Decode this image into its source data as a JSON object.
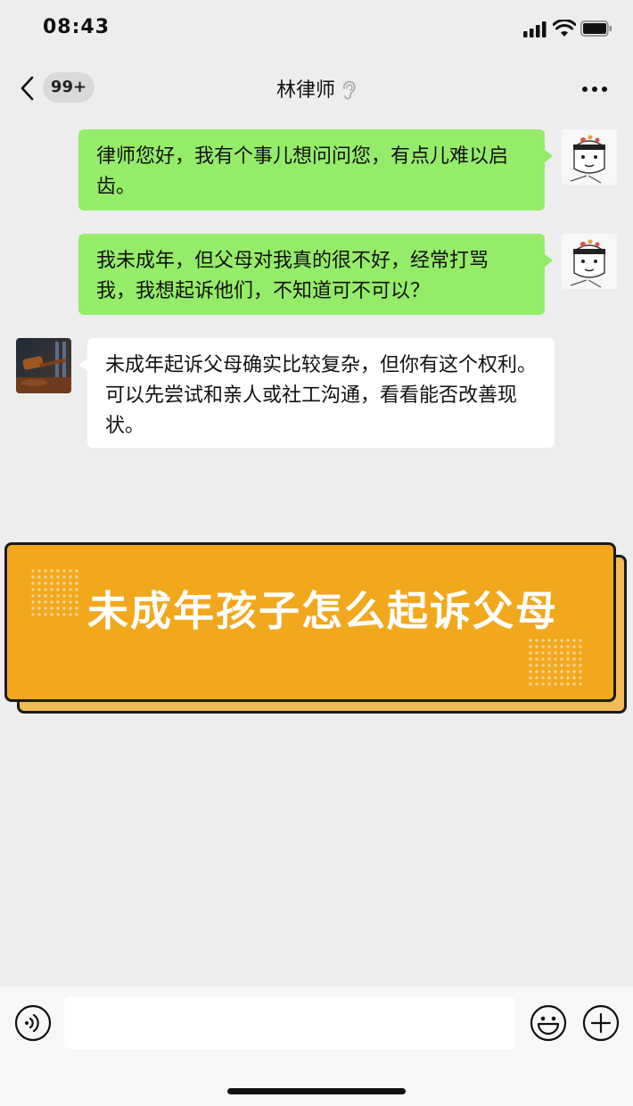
{
  "status_bar": {
    "time": "08:43"
  },
  "nav": {
    "unread_badge": "99+",
    "title": "林律师",
    "ear_icon": "ear-icon",
    "more_icon": "more-dots-icon"
  },
  "messages": [
    {
      "from": "me",
      "text": "律师您好，我有个事儿想问问您，有点儿难以启齿。"
    },
    {
      "from": "me",
      "text": "我未成年，但父母对我真的很不好，经常打骂我，我想起诉他们，不知道可不可以？"
    },
    {
      "from": "lawyer",
      "text": "未成年起诉父母确实比较复杂，但你有这个权利。可以先尝试和亲人或社工沟通，看看能否改善现状。"
    }
  ],
  "banner": {
    "text": "未成年孩子怎么起诉父母",
    "color": "#f2a81d"
  },
  "input_bar": {
    "voice_icon": "voice-icon",
    "input_value": "",
    "emoji_icon": "emoji-icon",
    "plus_icon": "plus-icon"
  },
  "colors": {
    "my_bubble": "#95ec69",
    "their_bubble": "#ffffff",
    "background": "#ededed"
  }
}
